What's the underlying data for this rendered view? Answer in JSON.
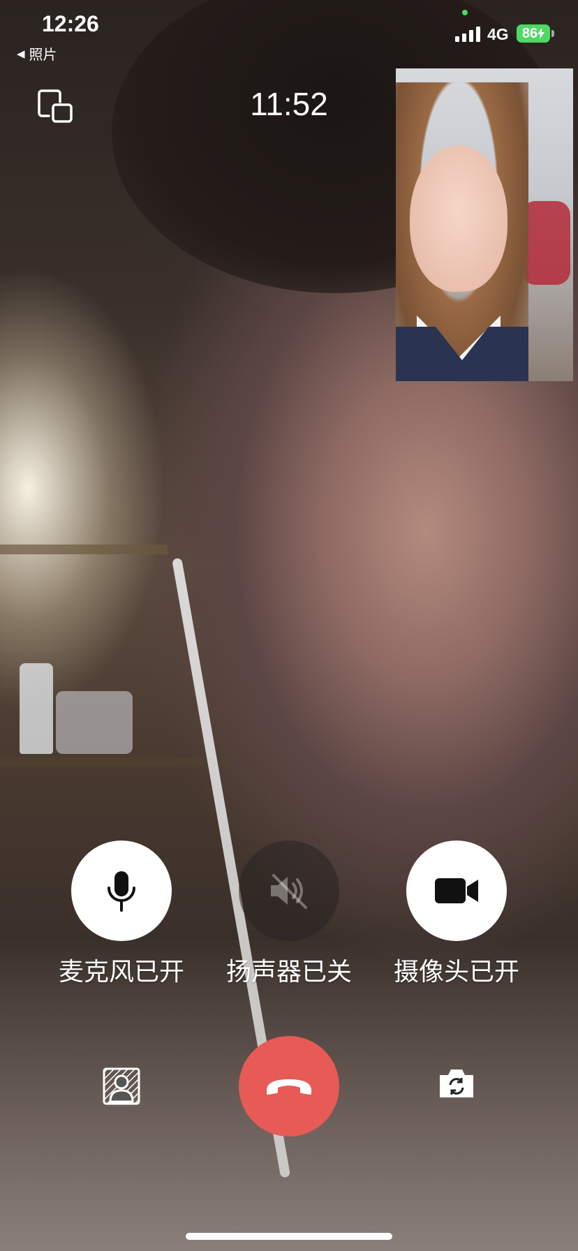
{
  "status_bar": {
    "time": "12:26",
    "back_app": "照片",
    "network": "4G",
    "battery": "86"
  },
  "call": {
    "duration": "11:52"
  },
  "controls": {
    "mic_label": "麦克风已开",
    "speaker_label": "扬声器已关",
    "camera_label": "摄像头已开"
  },
  "icons": {
    "minimize": "minimize-window-icon",
    "mic": "microphone-icon",
    "speaker": "speaker-muted-icon",
    "camera": "video-camera-icon",
    "blur": "background-blur-icon",
    "hangup": "hang-up-phone-icon",
    "switch_camera": "switch-camera-icon"
  },
  "colors": {
    "hangup": "#e75a56",
    "battery": "#4cd964",
    "control_on": "#ffffff",
    "control_off": "rgba(40,35,33,0.55)"
  }
}
